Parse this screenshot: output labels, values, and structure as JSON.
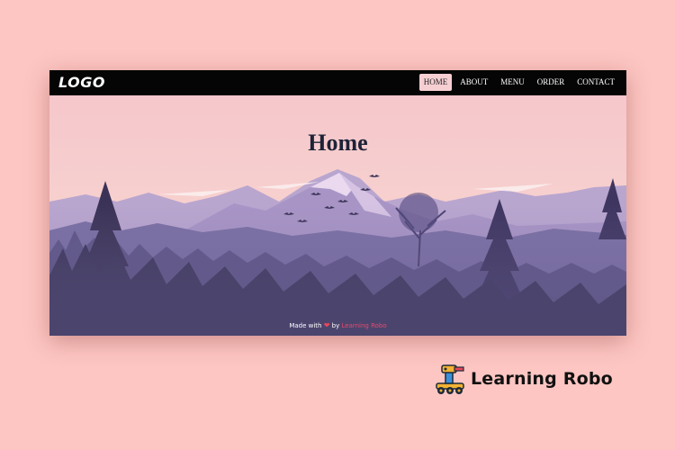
{
  "navbar": {
    "logo": "LOGO",
    "links": [
      {
        "label": "HOME",
        "active": true
      },
      {
        "label": "ABOUT",
        "active": false
      },
      {
        "label": "MENU",
        "active": false
      },
      {
        "label": "ORDER",
        "active": false
      },
      {
        "label": "CONTACT",
        "active": false
      }
    ]
  },
  "hero": {
    "title": "Home",
    "footer_prefix": "Made with",
    "footer_by": "by",
    "footer_brand": "Learning Robo"
  },
  "badge": {
    "icon": "robot-icon",
    "text": "Learning Robo"
  },
  "colors": {
    "background": "#fdc6c2",
    "navbar": "#050505",
    "active_link_bg": "#f6cfd3",
    "title": "#1e2338",
    "heart": "#e8485a"
  }
}
